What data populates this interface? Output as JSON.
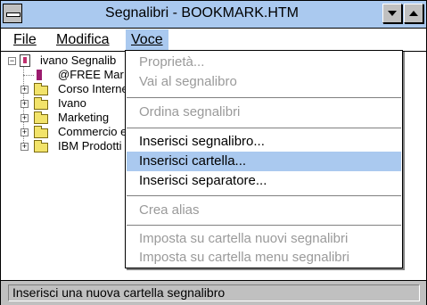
{
  "window": {
    "title": "Segnalibri - BOOKMARK.HTM"
  },
  "menubar": {
    "items": [
      {
        "label": "File"
      },
      {
        "label": "Modifica"
      },
      {
        "label": "Voce"
      }
    ]
  },
  "tree": {
    "root": {
      "label": "ivano Segnalib",
      "icon": "bookmark-file-icon"
    },
    "items": [
      {
        "label": "@FREE Mar",
        "icon": "bookmark-icon",
        "expander": ""
      },
      {
        "label": "Corso Interne",
        "icon": "folder-icon",
        "expander": "+"
      },
      {
        "label": "Ivano",
        "icon": "folder-icon",
        "expander": "+"
      },
      {
        "label": "Marketing",
        "icon": "folder-icon",
        "expander": "+"
      },
      {
        "label": "Commercio e",
        "icon": "folder-icon",
        "expander": "+"
      },
      {
        "label": "IBM Prodotti",
        "icon": "folder-icon",
        "expander": "+"
      }
    ]
  },
  "dropdown": {
    "items": [
      {
        "label": "Proprietà...",
        "enabled": false
      },
      {
        "label": "Vai al segnalibro",
        "enabled": false
      },
      {
        "label": "Ordina segnalibri",
        "enabled": false
      },
      {
        "label": "Inserisci segnalibro...",
        "enabled": true
      },
      {
        "label": "Inserisci cartella...",
        "enabled": true,
        "selected": true
      },
      {
        "label": "Inserisci separatore...",
        "enabled": true
      },
      {
        "label": "Crea alias",
        "enabled": false
      },
      {
        "label": "Imposta su cartella nuovi segnalibri",
        "enabled": false
      },
      {
        "label": "Imposta su cartella menu segnalibri",
        "enabled": false
      }
    ]
  },
  "status": {
    "text": "Inserisci una nuova cartella segnalibro"
  },
  "colors": {
    "highlight": "#aac9ef",
    "disabled_text": "#9a9a9a",
    "chrome": "#c0c0c0"
  }
}
